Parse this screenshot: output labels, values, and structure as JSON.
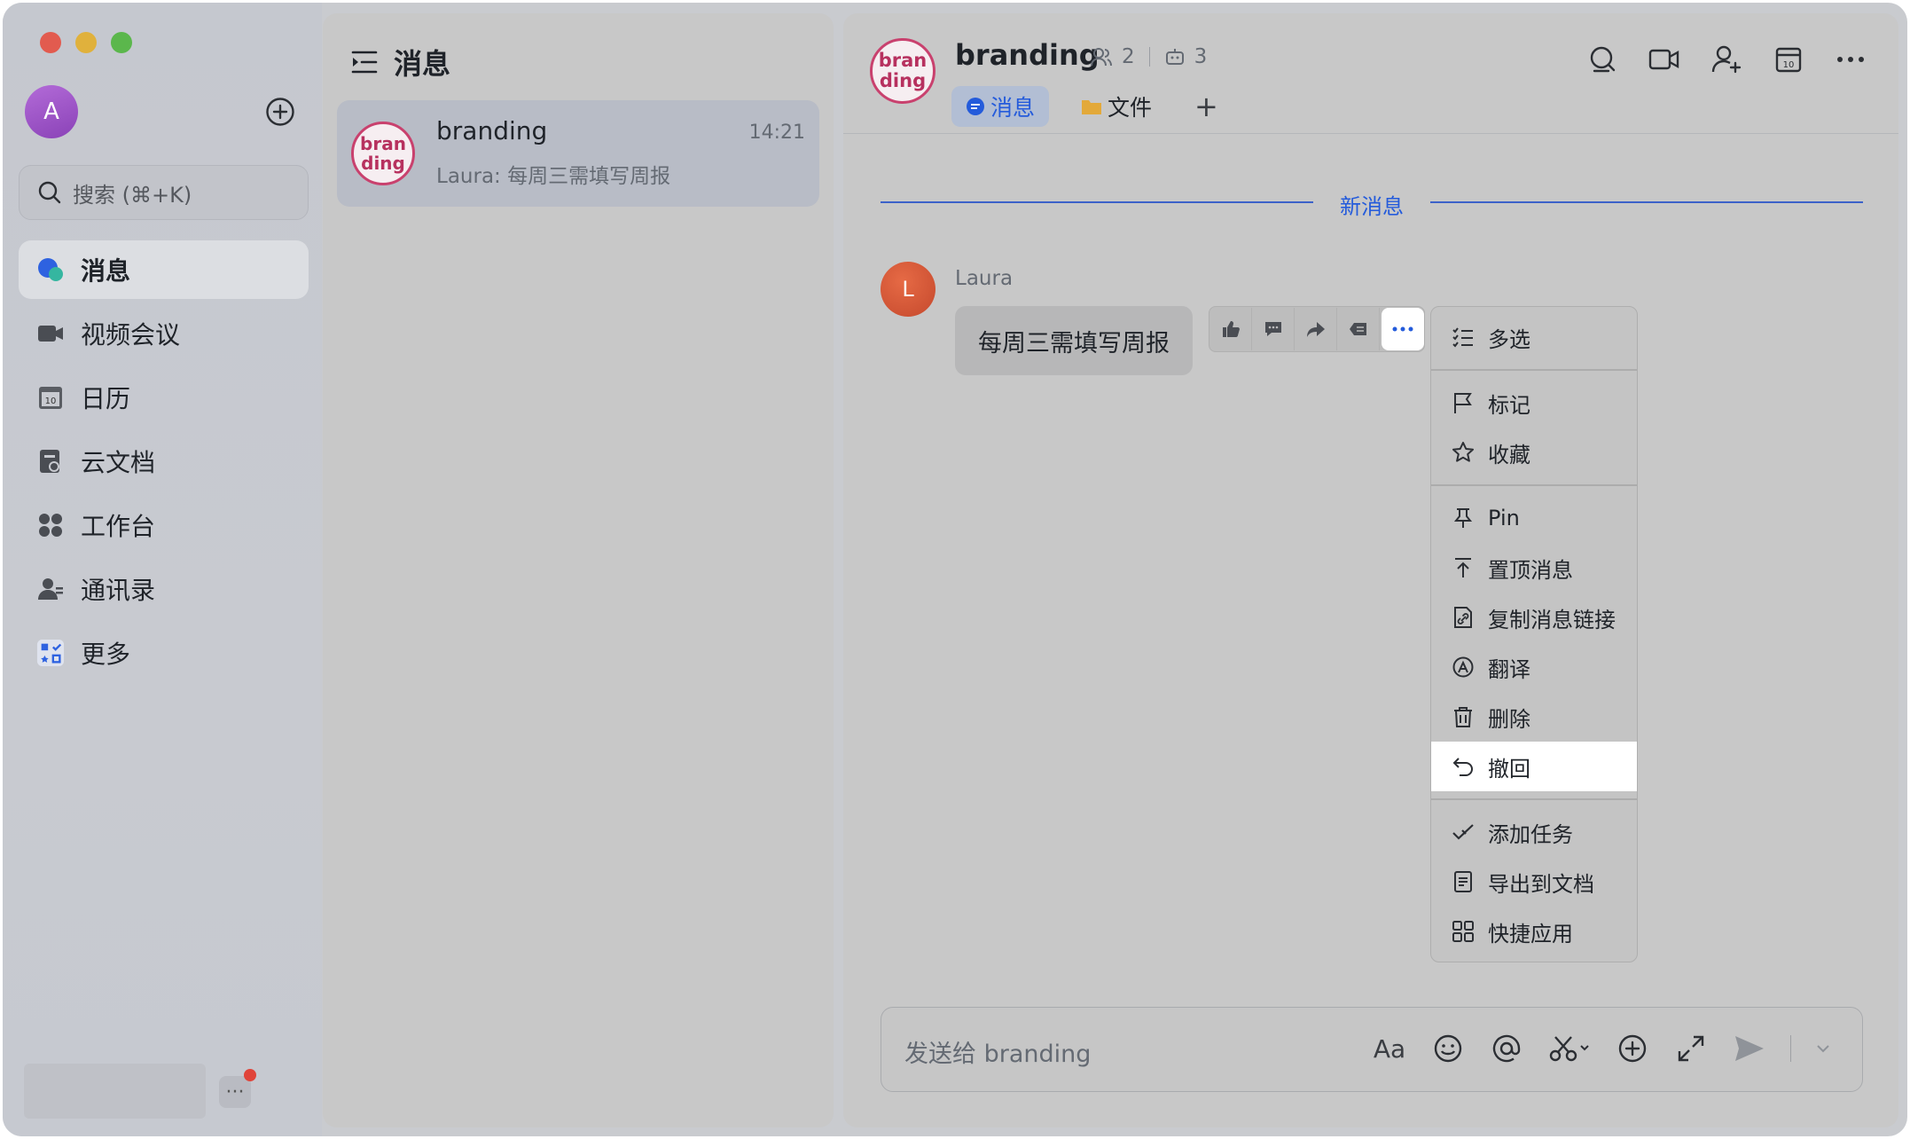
{
  "sidebar": {
    "user_initial": "A",
    "search_placeholder": "搜索 (⌘+K)",
    "items": [
      {
        "label": "消息",
        "icon": "chat-bubble-icon",
        "active": true
      },
      {
        "label": "视频会议",
        "icon": "video-camera-icon"
      },
      {
        "label": "日历",
        "icon": "calendar-icon"
      },
      {
        "label": "云文档",
        "icon": "cloud-doc-icon"
      },
      {
        "label": "工作台",
        "icon": "workspace-grid-icon"
      },
      {
        "label": "通讯录",
        "icon": "contacts-icon"
      },
      {
        "label": "更多",
        "icon": "more-apps-icon"
      }
    ]
  },
  "list": {
    "title": "消息",
    "chat": {
      "logo_line1": "bran",
      "logo_line2": "ding",
      "name": "branding",
      "time": "14:21",
      "preview": "Laura: 每周三需填写周报"
    }
  },
  "chat": {
    "logo_line1": "bran",
    "logo_line2": "ding",
    "title": "branding",
    "members": "2",
    "bots": "3",
    "tabs": [
      {
        "label": "消息",
        "active": true
      },
      {
        "label": "文件"
      }
    ],
    "tab_add": "+",
    "new_messages_label": "新消息",
    "message": {
      "sender": "Laura",
      "sender_initial": "L",
      "text": "每周三需填写周报"
    },
    "input_placeholder": "发送给 branding",
    "font_tool_label": "Aa"
  },
  "context_menu": {
    "groups": [
      [
        {
          "label": "多选",
          "icon": "multi-select-icon"
        }
      ],
      [
        {
          "label": "标记",
          "icon": "flag-icon"
        },
        {
          "label": "收藏",
          "icon": "star-icon"
        }
      ],
      [
        {
          "label": "Pin",
          "icon": "pin-icon"
        },
        {
          "label": "置顶消息",
          "icon": "pin-top-icon"
        },
        {
          "label": "复制消息链接",
          "icon": "copy-link-icon"
        },
        {
          "label": "翻译",
          "icon": "translate-icon"
        },
        {
          "label": "删除",
          "icon": "trash-icon"
        },
        {
          "label": "撤回",
          "icon": "undo-icon",
          "highlight": true
        }
      ],
      [
        {
          "label": "添加任务",
          "icon": "task-check-icon"
        },
        {
          "label": "导出到文档",
          "icon": "export-doc-icon"
        },
        {
          "label": "快捷应用",
          "icon": "quick-apps-icon"
        }
      ]
    ]
  },
  "colors": {
    "accent": "#245bdb",
    "brand_logo": "#c9416e",
    "notification_dot": "#e0443a"
  }
}
